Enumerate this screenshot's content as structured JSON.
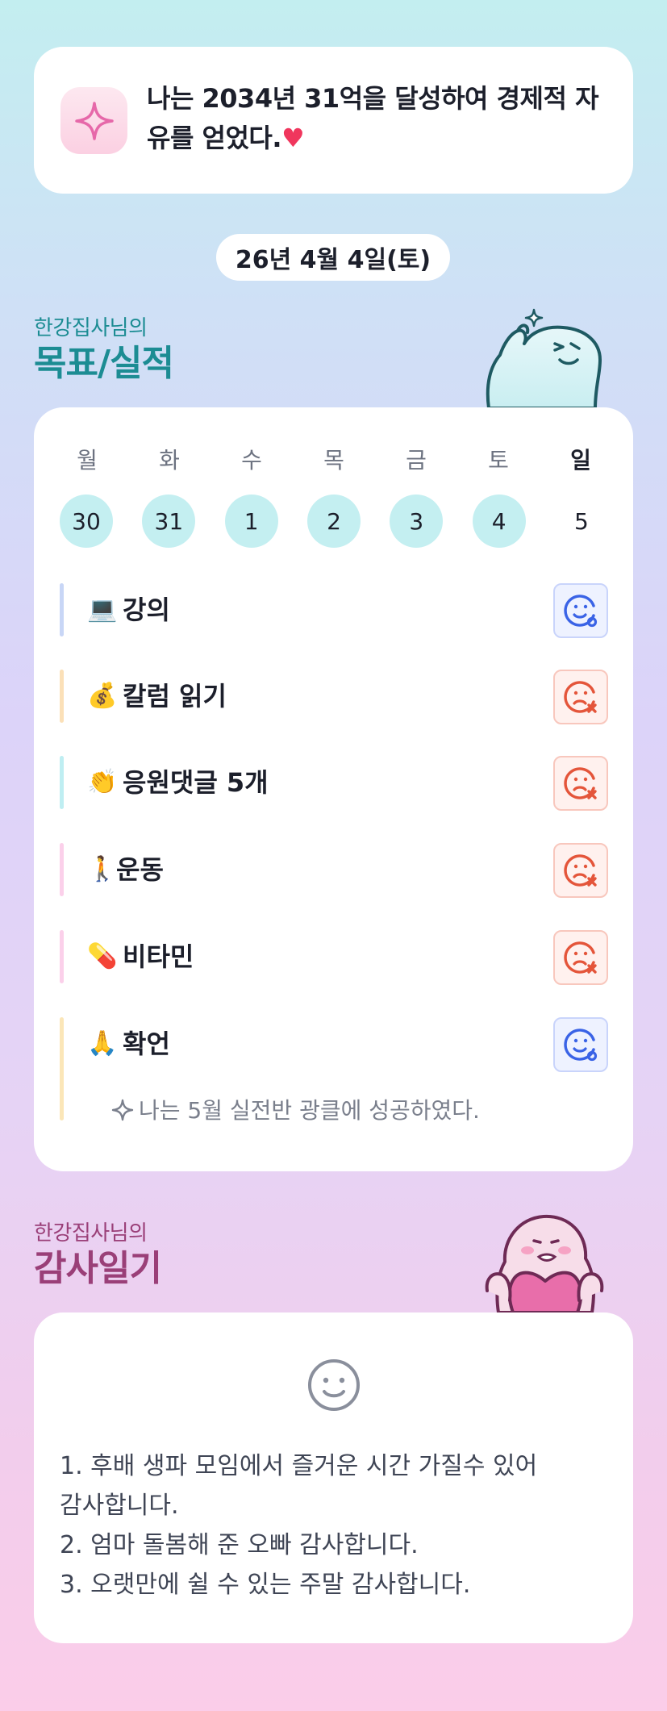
{
  "goal": {
    "line1": "나는 2034년 31억을 달성하여 경제적 자",
    "line2": "유를 얻었다.",
    "heart": "♥",
    "icon": "sparkle-icon"
  },
  "date": "26년 4월 4일(토)",
  "goals_section": {
    "subtitle": "한강집사님의",
    "title": "목표/실적"
  },
  "week": {
    "days_of_week": [
      "월",
      "화",
      "수",
      "목",
      "금",
      "토",
      "일"
    ],
    "dates": [
      "30",
      "31",
      "1",
      "2",
      "3",
      "4",
      "5"
    ]
  },
  "tasks": [
    {
      "emoji": "💻",
      "label": "강의",
      "status": "done",
      "bar_color": "#c8d6f6"
    },
    {
      "emoji": "💰",
      "label": "칼럼 읽기",
      "status": "missed",
      "bar_color": "#fbe0b8"
    },
    {
      "emoji": "👏",
      "label": "응원댓글 5개",
      "status": "missed",
      "bar_color": "#bfeef2"
    },
    {
      "emoji": "🚶",
      "label": "운동",
      "status": "missed",
      "bar_color": "#fbd0ea"
    },
    {
      "emoji": "💊",
      "label": "비타민",
      "status": "missed",
      "bar_color": "#fbd0ea"
    },
    {
      "emoji": "🙏",
      "label": "확언",
      "status": "done",
      "bar_color": "#fbe6b8",
      "note": "나는 5월 실전반 광클에 성공하였다."
    }
  ],
  "thanks_section": {
    "subtitle": "한강집사님의",
    "title": "감사일기"
  },
  "thanks": {
    "icon": "smile-icon",
    "lines": [
      "1. 후배 생파 모임에서 즐거운 시간 가질수 있어",
      "감사합니다.",
      "2. 엄마 돌봄해 준 오빠 감사합니다.",
      "3. 오랫만에 쉴 수 있는 주말 감사합니다."
    ]
  },
  "colors": {
    "teal_title": "#1c8c93",
    "plum_title": "#9a3f78",
    "done": "#3a63e6",
    "missed": "#e4553a",
    "date_circle": "#c4eff1"
  }
}
